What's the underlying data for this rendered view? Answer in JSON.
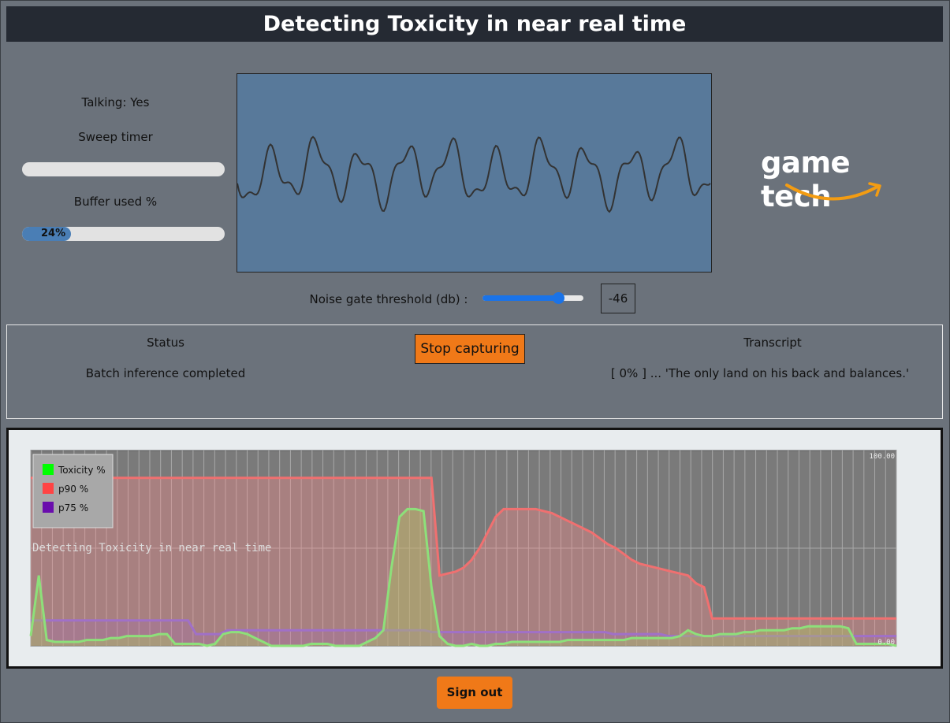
{
  "header": {
    "title": "Detecting Toxicity in near real time"
  },
  "left": {
    "talking_label": "Talking: Yes",
    "sweep_label": "Sweep timer",
    "sweep_progress": 0,
    "buffer_label": "Buffer used %",
    "buffer_progress": 24,
    "buffer_text": "24%"
  },
  "logo": {
    "text": "game tech"
  },
  "noise_gate": {
    "label": "Noise gate threshold (db) :",
    "value": "-46",
    "slider_fraction": 0.75
  },
  "status": {
    "status_header": "Status",
    "status_value": "Batch inference completed",
    "stop_button": "Stop capturing",
    "transcript_header": "Transcript",
    "transcript_value": "[ 0% ] ... 'The only land on his back and balances.'"
  },
  "chart_data": {
    "type": "area",
    "title": "Detecting Toxicity in near real time",
    "ylim": [
      0,
      100
    ],
    "y_max_label": "100.00",
    "y_min_label": "0.00",
    "legend_position": "top-left",
    "grid": true,
    "series": [
      {
        "name": "Toxicity %",
        "color": "#00ff00",
        "values": [
          5,
          36,
          3,
          2,
          2,
          2,
          2,
          3,
          3,
          3,
          4,
          4,
          5,
          5,
          5,
          5,
          6,
          6,
          1,
          1,
          1,
          1,
          0,
          1,
          6,
          7,
          7,
          6,
          4,
          2,
          0,
          0,
          0,
          0,
          0,
          1,
          1,
          1,
          0,
          0,
          0,
          0,
          2,
          4,
          8,
          40,
          66,
          70,
          70,
          69,
          30,
          5,
          1,
          0,
          0,
          1,
          0,
          0,
          1,
          1,
          2,
          2,
          2,
          2,
          2,
          2,
          2,
          3,
          3,
          3,
          3,
          3,
          3,
          3,
          3,
          4,
          4,
          4,
          4,
          4,
          4,
          5,
          8,
          6,
          5,
          5,
          6,
          6,
          6,
          7,
          7,
          8,
          8,
          8,
          8,
          9,
          9,
          10,
          10,
          10,
          10,
          10,
          9,
          1,
          1,
          1,
          1,
          1,
          0
        ]
      },
      {
        "name": "p90 %",
        "color": "#ff4444",
        "values": [
          86,
          86,
          86,
          86,
          86,
          86,
          86,
          86,
          86,
          86,
          86,
          86,
          86,
          86,
          86,
          86,
          86,
          86,
          86,
          86,
          86,
          86,
          86,
          86,
          86,
          86,
          86,
          86,
          86,
          86,
          86,
          86,
          86,
          86,
          86,
          86,
          86,
          86,
          86,
          86,
          86,
          86,
          86,
          86,
          86,
          86,
          86,
          86,
          86,
          86,
          86,
          36,
          37,
          38,
          40,
          44,
          50,
          58,
          66,
          70,
          70,
          70,
          70,
          70,
          69,
          68,
          66,
          64,
          62,
          60,
          58,
          55,
          52,
          50,
          47,
          44,
          42,
          41,
          40,
          39,
          38,
          37,
          36,
          32,
          30,
          14,
          14,
          14,
          14,
          14,
          14,
          14,
          14,
          14,
          14,
          14,
          14,
          14,
          14,
          14,
          14,
          14,
          14,
          14,
          14,
          14,
          14,
          14,
          14
        ]
      },
      {
        "name": "p75 %",
        "color": "#6a0dad",
        "values": [
          13,
          13,
          13,
          13,
          13,
          13,
          13,
          13,
          13,
          13,
          13,
          13,
          13,
          13,
          13,
          13,
          13,
          13,
          13,
          13,
          13,
          6,
          6,
          6,
          6,
          8,
          8,
          8,
          8,
          8,
          8,
          8,
          8,
          8,
          8,
          8,
          8,
          8,
          8,
          8,
          8,
          8,
          8,
          8,
          8,
          8,
          8,
          8,
          8,
          8,
          8,
          7,
          7,
          7,
          7,
          7,
          7,
          7,
          7,
          7,
          7,
          7,
          7,
          7,
          7,
          7,
          7,
          7,
          7,
          7,
          7,
          7,
          7,
          7,
          6,
          6,
          6,
          6,
          6,
          6,
          6,
          5,
          5,
          5,
          5,
          5,
          5,
          5,
          5,
          5,
          5,
          5,
          5,
          5,
          5,
          5,
          5,
          5,
          5,
          5,
          5,
          5,
          5,
          5,
          5,
          5,
          5,
          5,
          5,
          5,
          5
        ]
      }
    ]
  },
  "signout": {
    "label": "Sign out"
  }
}
